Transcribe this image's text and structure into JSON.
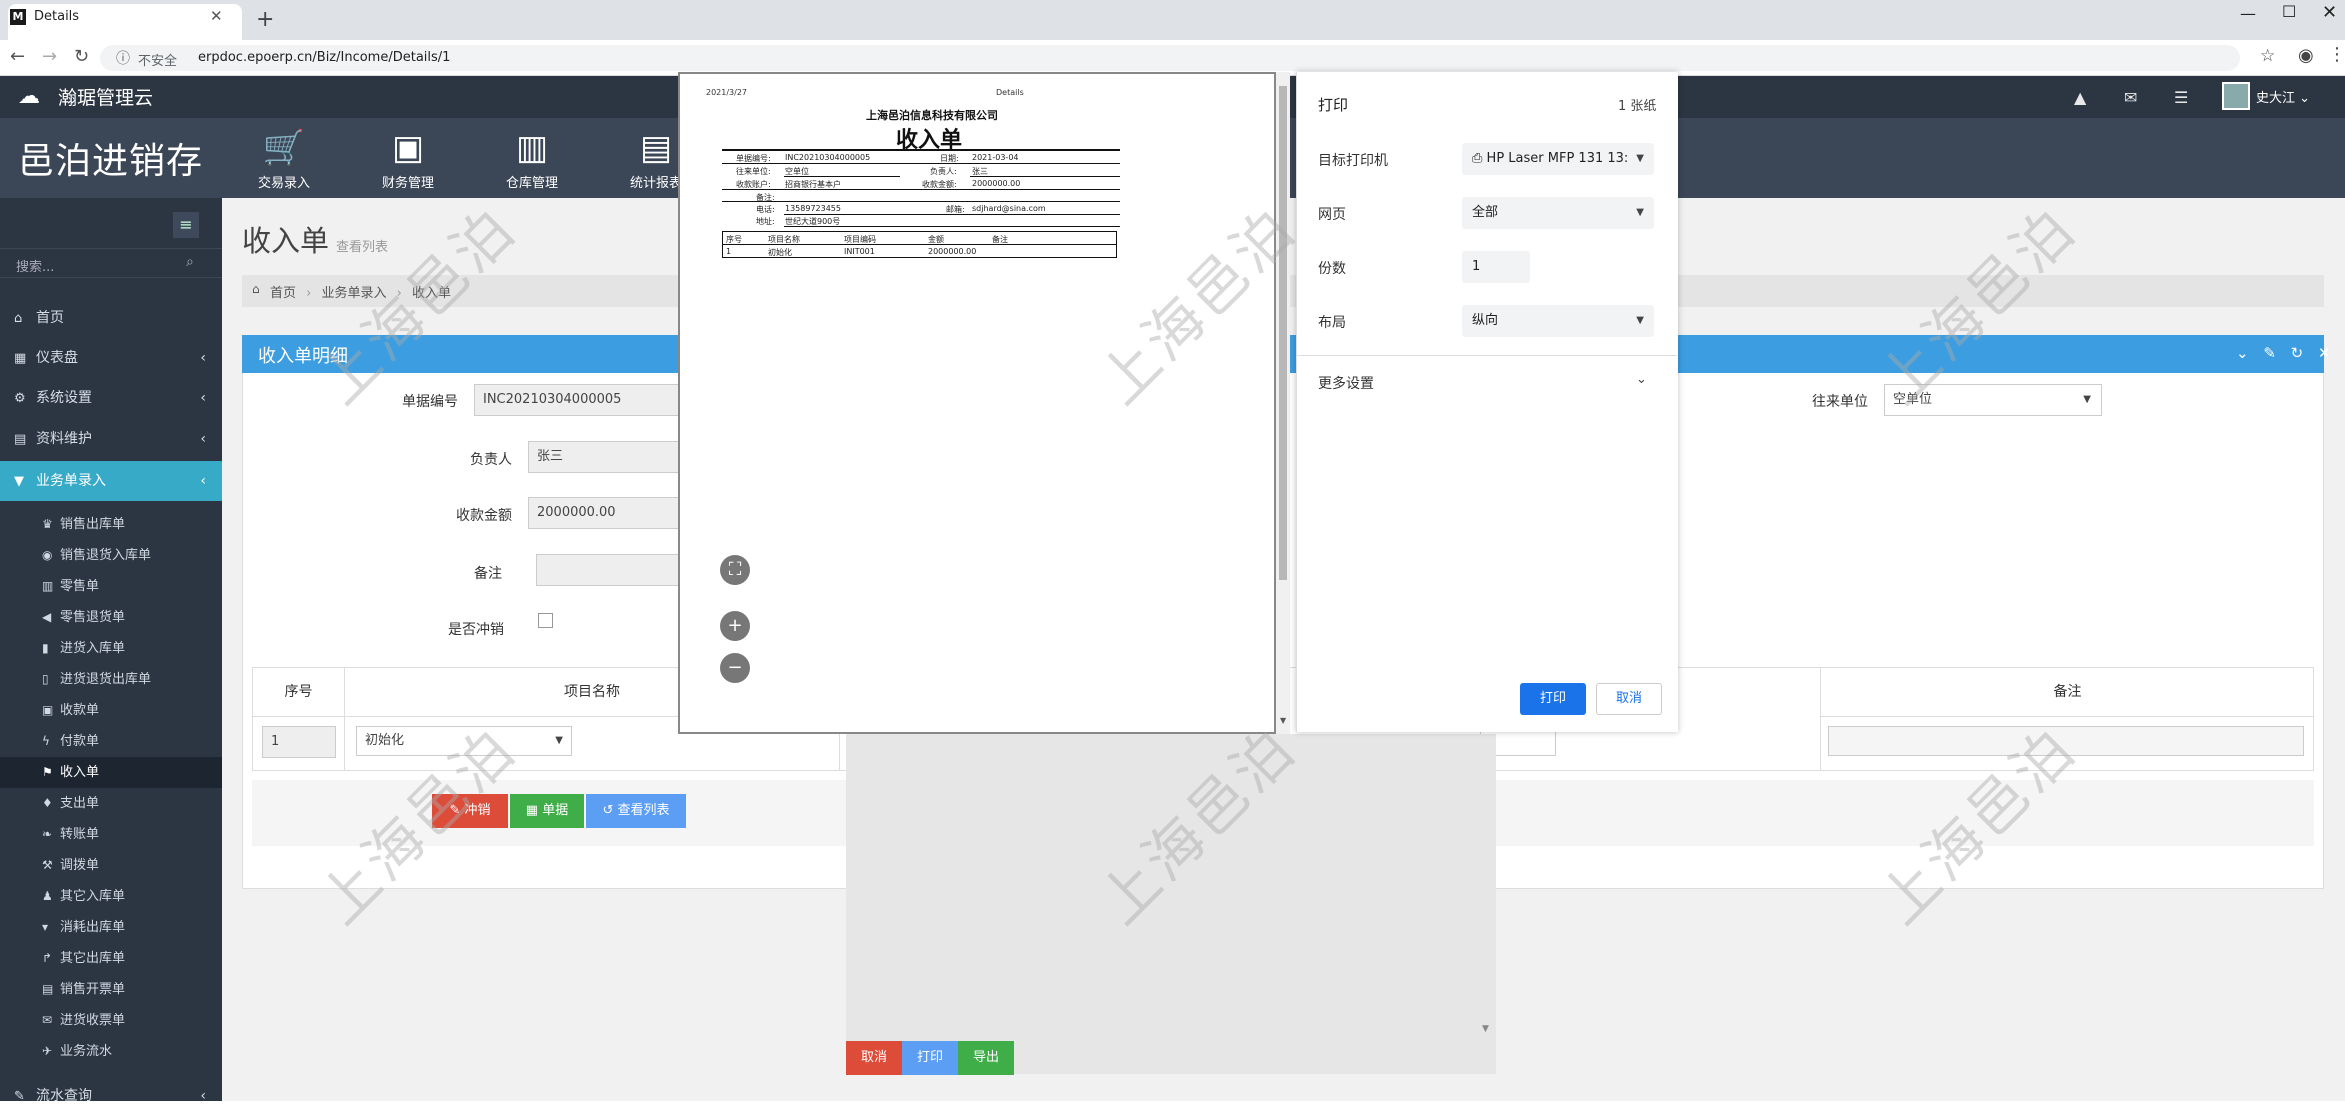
{
  "browser": {
    "tab_title": "Details",
    "tab_favicon": "M",
    "new_tab": "+",
    "security_label": "不安全",
    "url": "erpdoc.epoerp.cn/Biz/Income/Details/1",
    "win_min": "—",
    "win_max": "☐",
    "win_close": "✕"
  },
  "header": {
    "brand": "瀚琚管理云",
    "logo": "邑泊进销存",
    "user": "史大江",
    "modules": [
      {
        "label": "交易录入",
        "icon": "cart-icon"
      },
      {
        "label": "财务管理",
        "icon": "money-icon"
      },
      {
        "label": "仓库管理",
        "icon": "building-icon"
      },
      {
        "label": "统计报表",
        "icon": "chart-icon"
      }
    ]
  },
  "sidebar": {
    "search_placeholder": "搜索...",
    "items": [
      {
        "label": "首页",
        "icon": "home-icon"
      },
      {
        "label": "仪表盘",
        "icon": "dashboard-icon"
      },
      {
        "label": "系统设置",
        "icon": "cogs-icon"
      },
      {
        "label": "资料维护",
        "icon": "book-icon"
      },
      {
        "label": "业务单录入",
        "icon": "cart-icon"
      }
    ],
    "subitems": [
      "销售出库单",
      "销售退货入库单",
      "零售单",
      "零售退货单",
      "进货入库单",
      "进货退货出库单",
      "收款单",
      "付款单",
      "收入单",
      "支出单",
      "转账单",
      "调拨单",
      "其它入库单",
      "消耗出库单",
      "其它出库单",
      "销售开票单",
      "进货收票单",
      "业务流水"
    ],
    "flow": "流水查询"
  },
  "page": {
    "title": "收入单",
    "subtitle": "查看列表",
    "breadcrumb": [
      "首页",
      "业务单录入",
      "收入单"
    ],
    "panel_title": "收入单明细"
  },
  "form": {
    "doc_no_label": "单据编号",
    "doc_no": "INC20210304000005",
    "owner_label": "负责人",
    "owner": "张三",
    "amount_label": "收款金额",
    "amount": "2000000.00",
    "remark_label": "备注",
    "remark": "",
    "offset_label": "是否冲销",
    "partner_label": "往来单位",
    "partner": "空单位"
  },
  "table": {
    "headers": [
      "序号",
      "项目名称",
      "备注"
    ],
    "rows": [
      {
        "no": "1",
        "item": "初始化"
      }
    ]
  },
  "buttons": {
    "offset": "冲销",
    "doc": "单据",
    "list": "查看列表"
  },
  "preview": {
    "date": "2021/3/27",
    "doc_title": "Details",
    "company": "上海邑泊信息科技有限公司",
    "title": "收入单",
    "fields": {
      "doc_no_label": "单据编号:",
      "doc_no": "INC20210304000005",
      "date_label": "日期:",
      "date": "2021-03-04",
      "partner_label": "往来单位:",
      "partner": "空单位",
      "owner_label": "负责人:",
      "owner": "张三",
      "account_label": "收款账户:",
      "account": "招商银行基本户",
      "amount_label": "收款金额:",
      "amount": "2000000.00",
      "remark_label": "备注:",
      "phone_label": "电话:",
      "phone": "13589723455",
      "email_label": "邮箱:",
      "email": "sdjhard@sina.com",
      "address_label": "地址:",
      "address": "世纪大道900号"
    },
    "table_headers": [
      "序号",
      "项目名称",
      "项目编码",
      "金额",
      "备注"
    ],
    "table_row": [
      "1",
      "初始化",
      "INIT001",
      "2000000.00",
      ""
    ],
    "zoom_fit": "⛶",
    "zoom_in": "+",
    "zoom_out": "−"
  },
  "print": {
    "title": "打印",
    "pages": "1 张纸",
    "printer_label": "目标打印机",
    "printer": "HP Laser MFP 131 13:",
    "pages_label": "网页",
    "pages_value": "全部",
    "copies_label": "份数",
    "copies": "1",
    "layout_label": "布局",
    "layout": "纵向",
    "more": "更多设置",
    "print_btn": "打印",
    "cancel_btn": "取消"
  },
  "lower_buttons": {
    "cancel": "取消",
    "print": "打印",
    "export": "导出"
  },
  "watermark": "上海邑泊",
  "colors": {
    "accent": "#3c9de1",
    "active": "#37aac8",
    "danger": "#dd4b39",
    "success": "#3fae49",
    "info": "#5c9ef4"
  }
}
